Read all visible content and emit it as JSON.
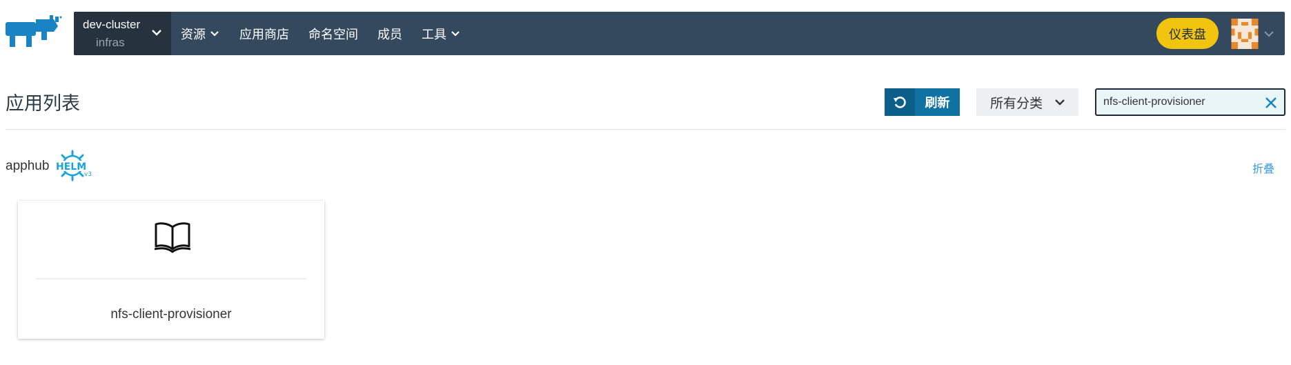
{
  "header": {
    "cluster_name": "dev-cluster",
    "project_name": "infras",
    "nav": [
      {
        "label": "资源",
        "has_dropdown": true
      },
      {
        "label": "应用商店",
        "has_dropdown": false
      },
      {
        "label": "命名空间",
        "has_dropdown": false
      },
      {
        "label": "成员",
        "has_dropdown": false
      },
      {
        "label": "工具",
        "has_dropdown": true
      }
    ],
    "dashboard_label": "仪表盘",
    "logo_icon": "rancher-cow-logo",
    "avatar_icon": "pixel-avatar"
  },
  "toolbar": {
    "title": "应用列表",
    "refresh_label": "刷新",
    "category_label": "所有分类",
    "search": {
      "value": "nfs-client-provisioner",
      "placeholder": ""
    }
  },
  "catalog": {
    "name": "apphub",
    "helm_badge": "HELM",
    "helm_version": "v3",
    "collapse_label": "折叠",
    "apps": [
      {
        "name": "nfs-client-provisioner",
        "icon": "open-book-icon"
      }
    ]
  },
  "colors": {
    "navbar": "#34495e",
    "cluster_bg": "#26323e",
    "dashboard_button": "#f1c40f",
    "primary_button": "#0f72a3",
    "link": "#3d98d3",
    "logo": "#1a83c4"
  }
}
